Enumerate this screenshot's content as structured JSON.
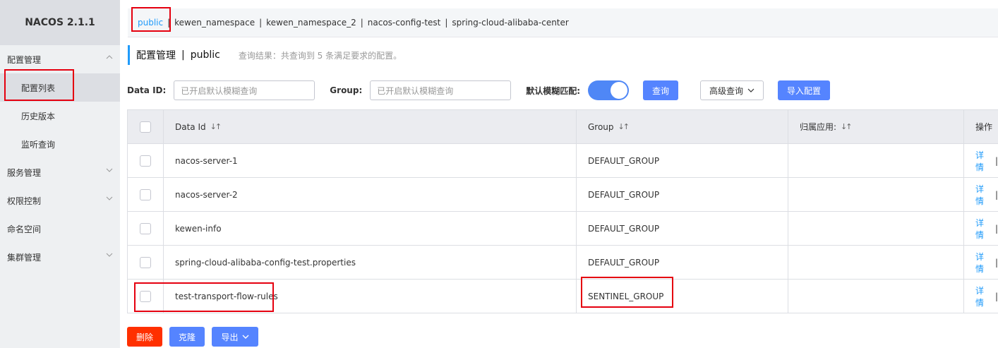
{
  "sidebar": {
    "logo": "NACOS 2.1.1",
    "groups": [
      {
        "label": "配置管理",
        "expanded": true,
        "items": [
          {
            "label": "配置列表",
            "active": true
          },
          {
            "label": "历史版本",
            "active": false
          },
          {
            "label": "监听查询",
            "active": false
          }
        ]
      },
      {
        "label": "服务管理",
        "expanded": false
      },
      {
        "label": "权限控制",
        "expanded": false
      },
      {
        "label": "命名空间"
      },
      {
        "label": "集群管理",
        "expanded": false
      }
    ]
  },
  "namespaces": [
    "public",
    "kewen_namespace",
    "kewen_namespace_2",
    "nacos-config-test",
    "spring-cloud-alibaba-center"
  ],
  "active_namespace": "public",
  "title": {
    "main": "配置管理",
    "sep": "|",
    "namespace": "public",
    "query_info": "查询结果：共查询到 5 条满足要求的配置。"
  },
  "search": {
    "dataid_label": "Data ID:",
    "dataid_placeholder": "已开启默认模糊查询",
    "group_label": "Group:",
    "group_placeholder": "已开启默认模糊查询",
    "fuzzy_label": "默认模糊匹配:",
    "fuzzy_on": true,
    "query_button": "查询",
    "advanced_button": "高级查询",
    "import_button": "导入配置"
  },
  "table": {
    "headers": {
      "dataid": "Data Id",
      "group": "Group",
      "app": "归属应用:",
      "ops": "操作"
    },
    "rows": [
      {
        "dataid": "nacos-server-1",
        "group": "DEFAULT_GROUP",
        "app": "",
        "op": "详情",
        "sep": "|"
      },
      {
        "dataid": "nacos-server-2",
        "group": "DEFAULT_GROUP",
        "app": "",
        "op": "详情",
        "sep": "|"
      },
      {
        "dataid": "kewen-info",
        "group": "DEFAULT_GROUP",
        "app": "",
        "op": "详情",
        "sep": "|"
      },
      {
        "dataid": "spring-cloud-alibaba-config-test.properties",
        "group": "DEFAULT_GROUP",
        "app": "",
        "op": "详情",
        "sep": "|"
      },
      {
        "dataid": "test-transport-flow-rules",
        "group": "SENTINEL_GROUP",
        "app": "",
        "op": "详情",
        "sep": "|"
      }
    ]
  },
  "bottom": {
    "delete": "删除",
    "clone": "克隆",
    "export": "导出"
  },
  "colors": {
    "accent": "#209bfa",
    "primary": "#5584ff",
    "danger": "#ff3000",
    "highlight": "#e5000f"
  }
}
